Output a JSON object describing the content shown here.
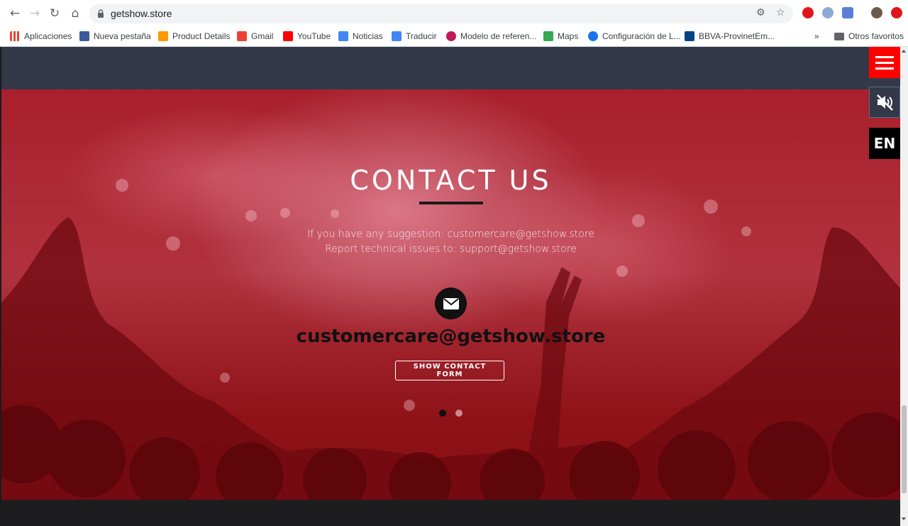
{
  "browser": {
    "url": "getshow.store",
    "bookmarks": [
      {
        "label": "Aplicaciones",
        "color": "#1a73e8"
      },
      {
        "label": "Nueva pestaña",
        "color": "#3b5998"
      },
      {
        "label": "Product Details",
        "color": "#ff9900"
      },
      {
        "label": "Gmail",
        "color": "#ea4335"
      },
      {
        "label": "YouTube",
        "color": "#ff0000"
      },
      {
        "label": "Noticias",
        "color": "#4285f4"
      },
      {
        "label": "Traducir",
        "color": "#4285f4"
      },
      {
        "label": "Modelo de referen...",
        "color": "#c2185b"
      },
      {
        "label": "Maps",
        "color": "#34a853"
      },
      {
        "label": "Configuración de L...",
        "color": "#1a73e8"
      },
      {
        "label": "BBVA-ProvinetEm...",
        "color": "#004481"
      }
    ],
    "overflow_label": "»",
    "other_favorites": "Otros favoritos"
  },
  "contact": {
    "title": "CONTACT US",
    "suggestion_line": "If you have any suggestion: customercare@getshow.store",
    "issues_line": "Report technical issues to: support@getshow.store",
    "email": "customercare@getshow.store",
    "button_label": "SHOW CONTACT FORM"
  },
  "carousel": {
    "active_index": 0,
    "count": 2
  },
  "widgets": {
    "language": "EN"
  },
  "colors": {
    "accent": "#ff0000",
    "hero": "#a8202c",
    "topbar": "#333948"
  }
}
